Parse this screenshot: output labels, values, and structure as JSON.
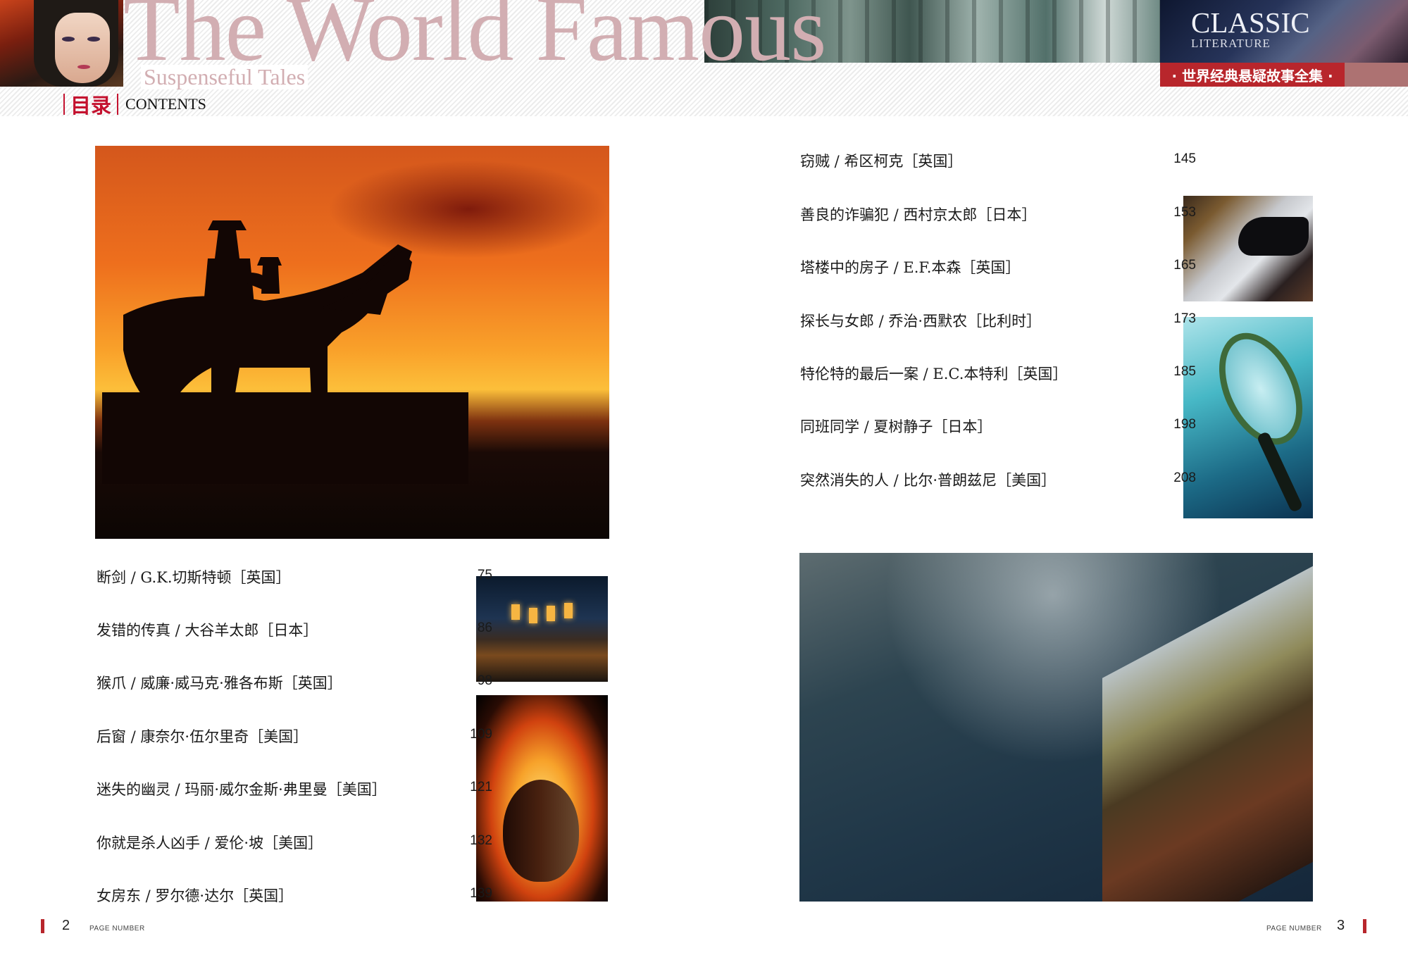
{
  "header": {
    "title_main": "The World Famous",
    "title_sub": "Suspenseful Tales",
    "contents_cn": "目录",
    "contents_en": "CONTENTS",
    "classic": "CLASSIC",
    "literature": "LITERATURE",
    "series_name": "· 世界经典悬疑故事全集 ·"
  },
  "toc_left": [
    {
      "title": "断剑 / G.K.切斯特顿［英国］",
      "page": "75"
    },
    {
      "title": "发错的传真 / 大谷羊太郎［日本］",
      "page": "86"
    },
    {
      "title": "猴爪 / 威廉·威马克·雅各布斯［英国］",
      "page": "98"
    },
    {
      "title": "后窗 / 康奈尔·伍尔里奇［美国］",
      "page": "109"
    },
    {
      "title": "迷失的幽灵 / 玛丽·威尔金斯·弗里曼［美国］",
      "page": "121"
    },
    {
      "title": "你就是杀人凶手 / 爱伦·坡［美国］",
      "page": "132"
    },
    {
      "title": "女房东 / 罗尔德·达尔［英国］",
      "page": "139"
    }
  ],
  "toc_right": [
    {
      "title": "窃贼 / 希区柯克［英国］",
      "page": "145"
    },
    {
      "title": "善良的诈骗犯 / 西村京太郎［日本］",
      "page": "153"
    },
    {
      "title": "塔楼中的房子 / E.F.本森［英国］",
      "page": "165"
    },
    {
      "title": "探长与女郎 / 乔治·西默农［比利时］",
      "page": "173"
    },
    {
      "title": "特伦特的最后一案 / E.C.本特利［英国］",
      "page": "185"
    },
    {
      "title": "同班同学 / 夏树静子［日本］",
      "page": "198"
    },
    {
      "title": "突然消失的人 / 比尔·普朗兹尼［美国］",
      "page": "208"
    }
  ],
  "footer": {
    "left_page": "2",
    "right_page": "3",
    "label": "PAGE NUMBER"
  },
  "colors": {
    "accent_red": "#c4122f",
    "title_pink": "#d2aeb2",
    "series_red": "#b8262c"
  }
}
